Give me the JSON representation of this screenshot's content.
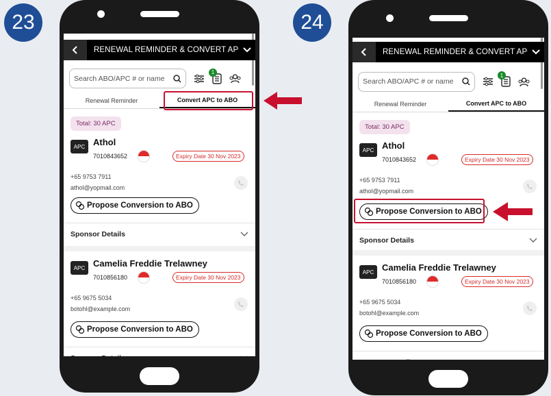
{
  "steps": [
    "23",
    "24"
  ],
  "header_title": "RENEWAL REMINDER & CONVERT APC TO",
  "search_placeholder": "Search ABO/APC # or name",
  "notification_count": "1",
  "tabs": [
    "Renewal Reminder",
    "Convert APC to ABO"
  ],
  "active_tab": "Convert APC to ABO",
  "total": "Total: 30 APC",
  "apc_tag": "APC",
  "propose_label": "Propose Conversion to ABO",
  "sponsor_label": "Sponsor Details",
  "cards": [
    {
      "name": "Athol",
      "abo": "7010843652",
      "expiry": "Expiry Date 30 Nov 2023",
      "phone": "+65 9753 7911",
      "email": "athol@yopmail.com"
    },
    {
      "name": "Camelia Freddie Trelawney",
      "abo": "7010856180",
      "expiry": "Expiry Date 30 Nov 2023",
      "phone": "+65 9675 5034",
      "email": "botohl@example.com"
    }
  ],
  "colors": {
    "badge": "#1f4e96",
    "highlight": "#c8102e",
    "flag_red": "#e02a2a",
    "notif_green": "#1a8a2a"
  },
  "icons": [
    "back-arrow-icon",
    "chevron-down-icon",
    "search-icon",
    "filter-icon",
    "checklist-icon",
    "people-icon",
    "singapore-flag-icon",
    "phone-icon",
    "convert-icon",
    "red-arrow-icon"
  ]
}
